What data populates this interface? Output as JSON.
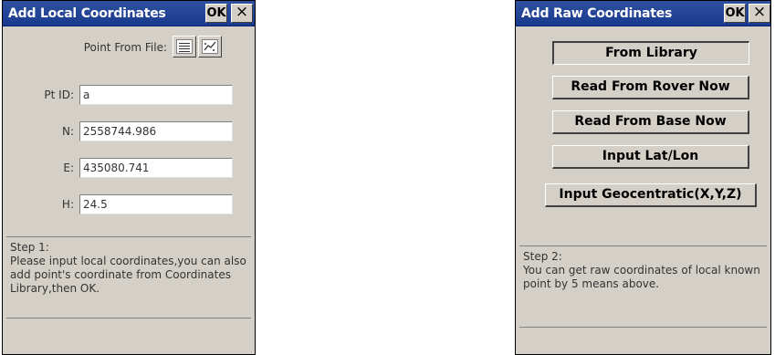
{
  "left_dialog": {
    "title": "Add Local Coordinates",
    "ok_label": "OK",
    "close_label": "×",
    "point_from_file_label": "Point From File:",
    "fields": [
      {
        "label": "Pt ID:",
        "value": "a"
      },
      {
        "label": "N:",
        "value": "2558744.986"
      },
      {
        "label": "E:",
        "value": "435080.741"
      },
      {
        "label": "H:",
        "value": "24.5"
      }
    ],
    "step_heading": "Step 1:",
    "step_text": "Please input local coordinates,you can also add point's coordinate from Coordinates Library,then OK."
  },
  "right_dialog": {
    "title": "Add Raw Coordinates",
    "ok_label": "OK",
    "close_label": "×",
    "buttons": [
      {
        "label": "From Library"
      },
      {
        "label": "Read From Rover Now"
      },
      {
        "label": "Read From Base Now"
      },
      {
        "label": "Input Lat/Lon"
      },
      {
        "label": "Input Geocentratic(X,Y,Z)"
      }
    ],
    "step_heading": "Step 2:",
    "step_text": "You can get raw coordinates of local known point by 5 means above."
  }
}
